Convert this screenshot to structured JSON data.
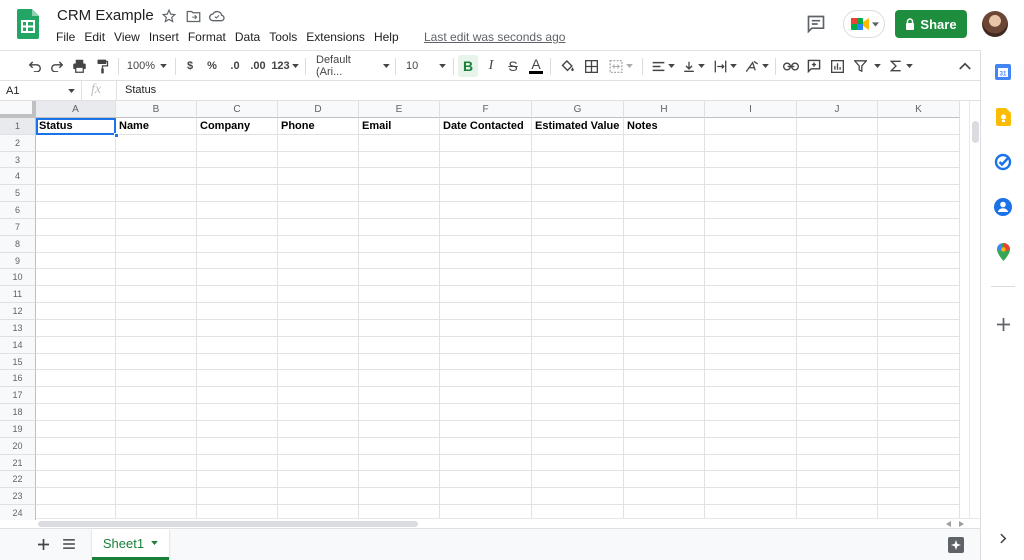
{
  "doc": {
    "title": "CRM Example",
    "last_edit": "Last edit was seconds ago"
  },
  "menu": [
    "File",
    "Edit",
    "View",
    "Insert",
    "Format",
    "Data",
    "Tools",
    "Extensions",
    "Help"
  ],
  "share_label": "Share",
  "toolbar": {
    "zoom": "100%",
    "currency": "$",
    "percent": "%",
    "dec_less": ".0",
    "dec_more": ".00",
    "format_more": "123",
    "font": "Default (Ari...",
    "font_size": "10",
    "bold": "B",
    "italic": "I",
    "strike": "S",
    "text_color": "A",
    "text_color_value": "#000000"
  },
  "formula_bar": {
    "cell_ref": "A1",
    "fx": "fx",
    "value": "Status"
  },
  "columns": [
    "A",
    "B",
    "C",
    "D",
    "E",
    "F",
    "G",
    "H",
    "I",
    "J",
    "K"
  ],
  "rows": [
    "1",
    "2",
    "3",
    "4",
    "5",
    "6",
    "7",
    "8",
    "9",
    "10",
    "11",
    "12",
    "13",
    "14",
    "15",
    "16",
    "17",
    "18",
    "19",
    "20",
    "21",
    "22",
    "23",
    "24"
  ],
  "header_cells": [
    "Status",
    "Name",
    "Company",
    "Phone",
    "Email",
    "Date Contacted",
    "Estimated Value",
    "Notes"
  ],
  "sheet_tab": "Sheet1",
  "colors": {
    "share": "#1e8e3e",
    "tab_active": "#188038",
    "selection": "#1a73e8"
  }
}
